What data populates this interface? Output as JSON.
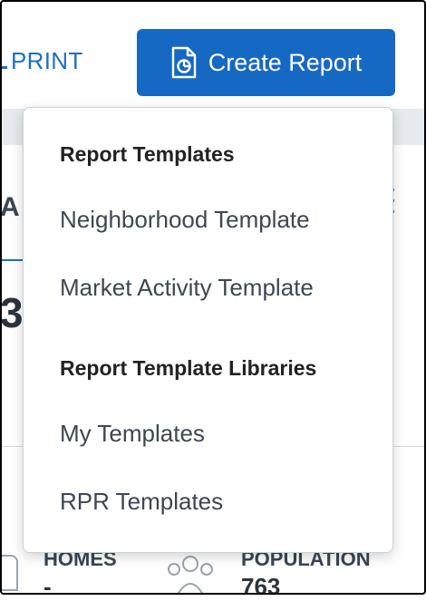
{
  "toolbar": {
    "print_label": "PRINT",
    "create_report_label": "Create Report"
  },
  "background": {
    "partial_heading": "A",
    "partial_value": "3",
    "stats": [
      {
        "label": "HOMES",
        "value": "-"
      },
      {
        "label": "POPULATION",
        "value": "763"
      }
    ]
  },
  "menu": {
    "sections": [
      {
        "header": "Report Templates",
        "items": [
          "Neighborhood Template",
          "Market Activity Template"
        ]
      },
      {
        "header": "Report Template Libraries",
        "items": [
          "My Templates",
          "RPR Templates"
        ]
      }
    ]
  },
  "colors": {
    "accent": "#1669c3",
    "link": "#1f6fc1",
    "menu_text": "#3d4752"
  },
  "icons": {
    "create_report": "report-document-icon",
    "population": "people-icon",
    "more": "kebab-icon"
  }
}
